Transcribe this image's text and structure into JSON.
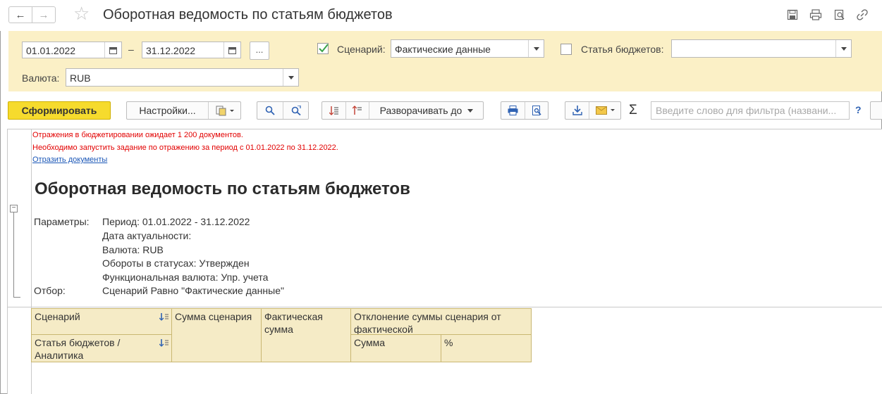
{
  "window": {
    "title": "Оборотная ведомость по статьям бюджетов"
  },
  "params": {
    "date_from": "01.01.2022",
    "date_to": "31.12.2022",
    "dash": "–",
    "ellipsis": "...",
    "scenario_label": "Сценарий:",
    "scenario_checked": true,
    "scenario_value": "Фактические данные",
    "budget_item_label": "Статья бюджетов:",
    "budget_item_checked": false,
    "budget_item_value": "",
    "currency_label": "Валюта:",
    "currency_value": "RUB"
  },
  "toolbar": {
    "generate": "Сформировать",
    "settings": "Настройки...",
    "expand_to": "Разворачивать до",
    "sigma": "Σ",
    "filter_placeholder": "Введите слово для фильтра (названи...",
    "help": "?"
  },
  "report": {
    "warning_1": "Отражения в бюджетировании ожидает 1 200 документов.",
    "warning_2": "Необходимо запустить задание по отражению за период с 01.01.2022 по 31.12.2022.",
    "link": "Отразить документы",
    "title": "Оборотная ведомость по статьям бюджетов",
    "params_label": "Параметры:",
    "params_lines": [
      "Период: 01.01.2022 - 31.12.2022",
      "Дата актуальности:",
      "Валюта: RUB",
      "Обороты в статусах: Утвержден",
      "Функциональная валюта: Упр. учета"
    ],
    "filter_label": "Отбор:",
    "filter_value": "Сценарий Равно \"Фактические данные\""
  },
  "table": {
    "col_scenario": "Сценарий",
    "col_item": "Статья бюджетов / Аналитика",
    "col_scenario_sum": "Сумма сценария",
    "col_actual_sum": "Фактическая сумма",
    "col_deviation": "Отклонение суммы сценария от фактической",
    "col_sum": "Сумма",
    "col_percent": "%"
  },
  "colors": {
    "param_panel_bg": "#fbf0c6",
    "primary_button": "#f6db2d",
    "warning_text": "#e20000",
    "link_text": "#1b57b7",
    "table_header_bg": "#f5ebc6"
  }
}
